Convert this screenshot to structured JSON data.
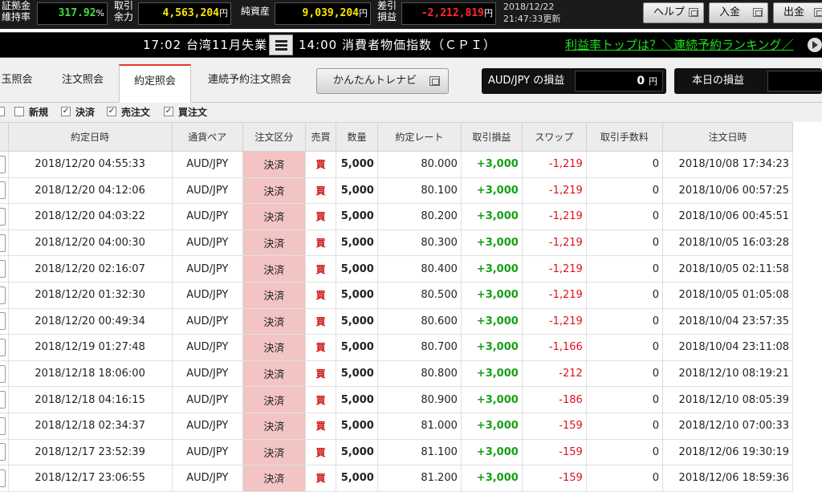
{
  "stats": {
    "margin_label_1": "証拠金",
    "margin_label_2": "維持率",
    "margin_value": "317.92",
    "margin_unit": "%",
    "available_label_1": "取引",
    "available_label_2": "余力",
    "available_value": "4,563,204",
    "yen_unit": "円",
    "net_assets_label": "純資産",
    "net_assets_value": "9,039,204",
    "pl_label_1": "差引",
    "pl_label_2": "損益",
    "pl_value": "-2,212,819",
    "updated_date": "2018/12/22",
    "updated_time": "21:47:33更新",
    "help_label": "ヘルプ",
    "deposit_label": "入金",
    "withdraw_label": "出金"
  },
  "ticker": {
    "item1": "17:02 台湾11月失業率",
    "item2": "14:00 消費者物価指数（ＣＰＩ）",
    "link": "利益率トップは？＼連続予約ランキング／"
  },
  "tabs": {
    "position": "玉照会",
    "order": "注文照会",
    "contract": "約定照会",
    "recurring": "連続予約注文照会",
    "navi_button": "かんたんトレナビ"
  },
  "pl_panels": {
    "pair_pl_label": "AUD/JPY の損益",
    "pair_pl_value": "0",
    "pair_pl_unit": "円",
    "today_pl_label": "本日の損益"
  },
  "filters": {
    "new": "新規",
    "settle": "決済",
    "sell_order": "売注文",
    "buy_order": "買注文",
    "check": "✓"
  },
  "table": {
    "headers": [
      "約定日時",
      "通貨ペア",
      "注文区分",
      "売買",
      "数量",
      "約定レート",
      "取引損益",
      "スワップ",
      "取引手数料",
      "注文日時"
    ],
    "rows": [
      [
        "2018/12/20 04:55:33",
        "AUD/JPY",
        "決済",
        "買",
        "5,000",
        "80.000",
        "+3,000",
        "-1,219",
        "0",
        "2018/10/08 17:34:23"
      ],
      [
        "2018/12/20 04:12:06",
        "AUD/JPY",
        "決済",
        "買",
        "5,000",
        "80.100",
        "+3,000",
        "-1,219",
        "0",
        "2018/10/06 00:57:25"
      ],
      [
        "2018/12/20 04:03:22",
        "AUD/JPY",
        "決済",
        "買",
        "5,000",
        "80.200",
        "+3,000",
        "-1,219",
        "0",
        "2018/10/06 00:45:51"
      ],
      [
        "2018/12/20 04:00:30",
        "AUD/JPY",
        "決済",
        "買",
        "5,000",
        "80.300",
        "+3,000",
        "-1,219",
        "0",
        "2018/10/05 16:03:28"
      ],
      [
        "2018/12/20 02:16:07",
        "AUD/JPY",
        "決済",
        "買",
        "5,000",
        "80.400",
        "+3,000",
        "-1,219",
        "0",
        "2018/10/05 02:11:58"
      ],
      [
        "2018/12/20 01:32:30",
        "AUD/JPY",
        "決済",
        "買",
        "5,000",
        "80.500",
        "+3,000",
        "-1,219",
        "0",
        "2018/10/05 01:05:08"
      ],
      [
        "2018/12/20 00:49:34",
        "AUD/JPY",
        "決済",
        "買",
        "5,000",
        "80.600",
        "+3,000",
        "-1,219",
        "0",
        "2018/10/04 23:57:35"
      ],
      [
        "2018/12/19 01:27:48",
        "AUD/JPY",
        "決済",
        "買",
        "5,000",
        "80.700",
        "+3,000",
        "-1,166",
        "0",
        "2018/10/04 23:11:08"
      ],
      [
        "2018/12/18 18:06:00",
        "AUD/JPY",
        "決済",
        "買",
        "5,000",
        "80.800",
        "+3,000",
        "-212",
        "0",
        "2018/12/10 08:19:21"
      ],
      [
        "2018/12/18 04:16:15",
        "AUD/JPY",
        "決済",
        "買",
        "5,000",
        "80.900",
        "+3,000",
        "-186",
        "0",
        "2018/12/10 08:05:39"
      ],
      [
        "2018/12/18 02:34:37",
        "AUD/JPY",
        "決済",
        "買",
        "5,000",
        "81.000",
        "+3,000",
        "-159",
        "0",
        "2018/12/10 07:00:33"
      ],
      [
        "2018/12/17 23:52:39",
        "AUD/JPY",
        "決済",
        "買",
        "5,000",
        "81.100",
        "+3,000",
        "-159",
        "0",
        "2018/12/06 19:30:19"
      ],
      [
        "2018/12/17 23:06:55",
        "AUD/JPY",
        "決済",
        "買",
        "5,000",
        "81.200",
        "+3,000",
        "-159",
        "0",
        "2018/12/06 18:59:36"
      ]
    ]
  },
  "colors": {
    "positive": "#13a013",
    "negative": "#e0101c",
    "settle_bg": "#f3c4c4",
    "active_tab_accent": "#e23a2e",
    "ticker_link": "#1ee01e"
  }
}
